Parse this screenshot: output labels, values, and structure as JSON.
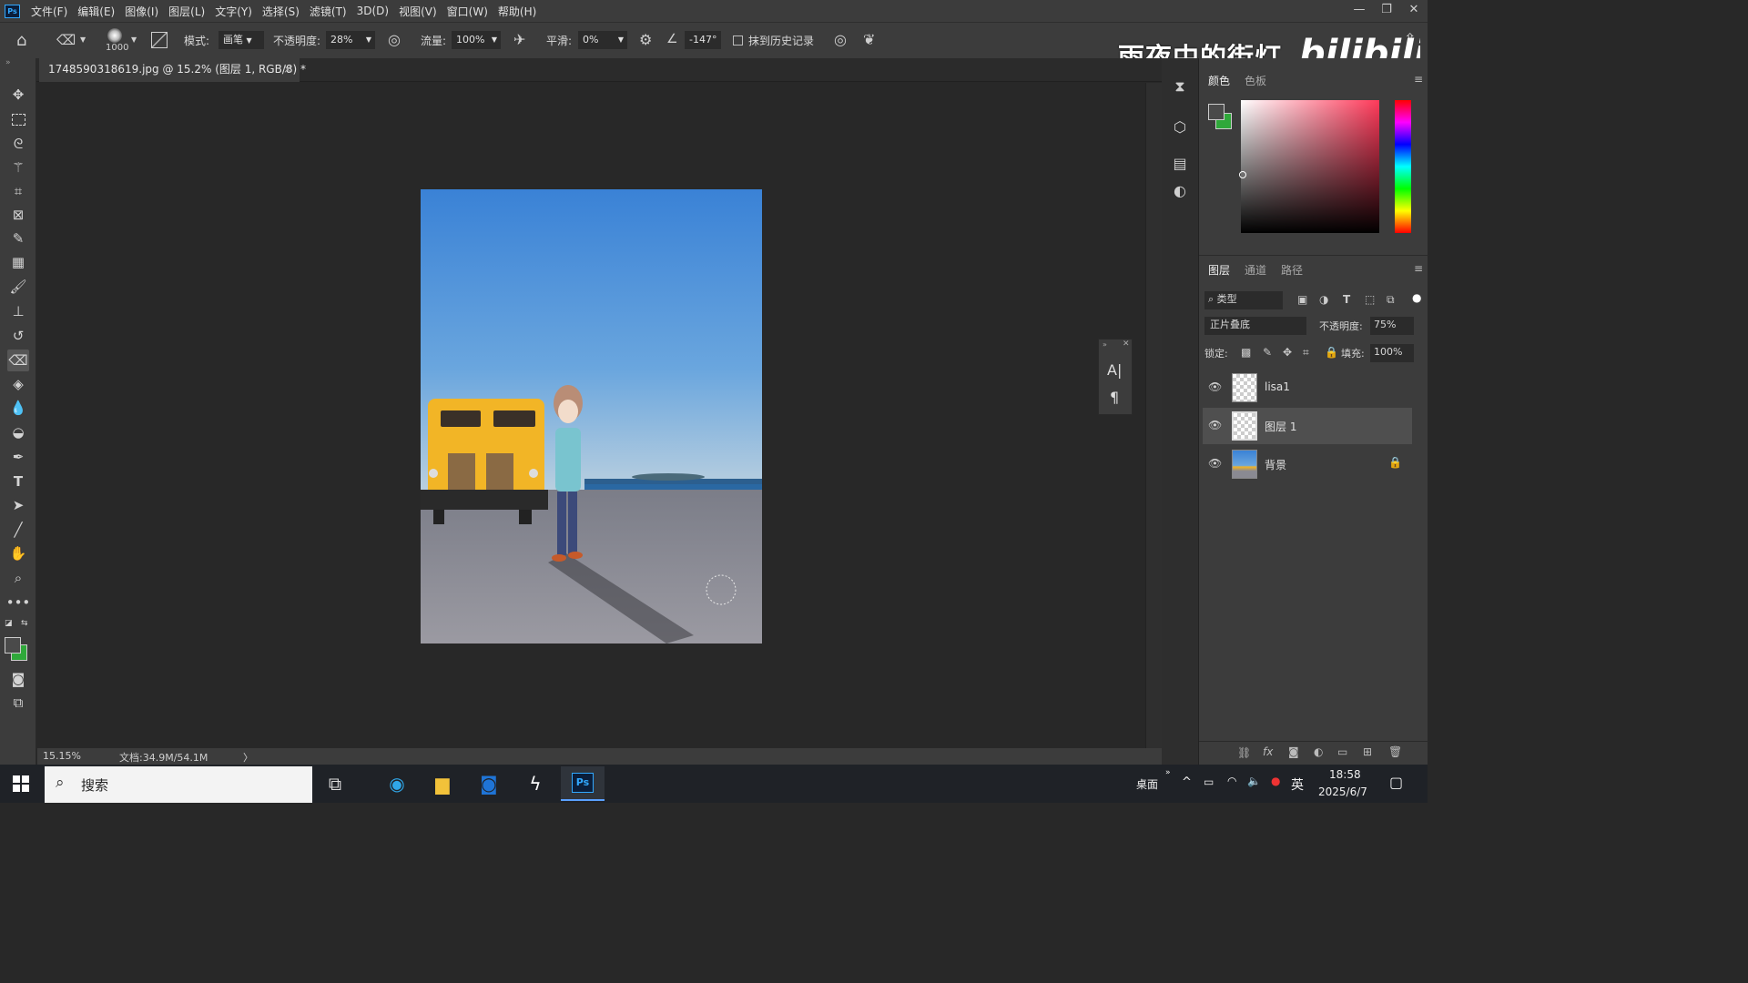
{
  "app": {
    "logo": "Ps"
  },
  "menu": [
    "文件(F)",
    "编辑(E)",
    "图像(I)",
    "图层(L)",
    "文字(Y)",
    "选择(S)",
    "滤镜(T)",
    "3D(D)",
    "视图(V)",
    "窗口(W)",
    "帮助(H)"
  ],
  "options": {
    "brush_size": "1000",
    "mode_label": "模式:",
    "mode_value": "画笔",
    "opacity_label": "不透明度:",
    "opacity_value": "28%",
    "flow_label": "流量:",
    "flow_value": "100%",
    "smooth_label": "平滑:",
    "smooth_value": "0%",
    "angle_value": "-147°",
    "erase_history_label": "抹到历史记录"
  },
  "watermark": {
    "text": "雨夜中的街灯",
    "logo": "bilibili"
  },
  "document": {
    "tab_title": "1748590318619.jpg @ 15.2% (图层 1, RGB/8) *",
    "close": "×"
  },
  "status": {
    "zoom": "15.15%",
    "doc_size": "文档:34.9M/54.1M",
    "arrow": "〉"
  },
  "color_panel": {
    "tabs": [
      "颜色",
      "色板"
    ],
    "foreground": "#4a4a4a",
    "background": "#2fa83a"
  },
  "layers_panel": {
    "tabs": [
      "图层",
      "通道",
      "路径"
    ],
    "filter_label": "类型",
    "blend_mode": "正片叠底",
    "opacity_label": "不透明度:",
    "opacity_value": "75%",
    "lock_label": "锁定:",
    "fill_label": "填充:",
    "fill_value": "100%",
    "layers": [
      {
        "name": "lisa1",
        "visible": true,
        "selected": false
      },
      {
        "name": "图层 1",
        "visible": true,
        "selected": true
      },
      {
        "name": "背景",
        "visible": true,
        "selected": false,
        "locked": true
      }
    ]
  },
  "taskbar": {
    "search_placeholder": "搜索",
    "desktop_label": "桌面",
    "ime": "英",
    "time": "18:58",
    "date": "2025/6/7",
    "ps_label": "Ps"
  }
}
